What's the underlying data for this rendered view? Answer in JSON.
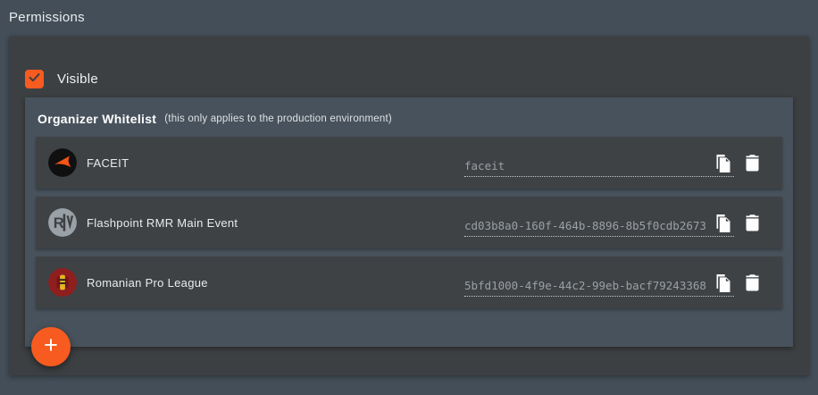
{
  "page": {
    "title": "Permissions"
  },
  "visible_checkbox": {
    "label": "Visible",
    "checked": true
  },
  "whitelist": {
    "title": "Organizer Whitelist",
    "note": "(this only applies to the production environment)",
    "rows": [
      {
        "name": "FACEIT",
        "value": "faceit"
      },
      {
        "name": "Flashpoint RMR Main Event",
        "value": "cd03b8a0-160f-464b-8896-8b5f0cdb2673"
      },
      {
        "name": "Romanian Pro League",
        "value": "5bfd1000-4f9e-44c2-99eb-bacf79243368"
      }
    ],
    "add_button_glyph": "+"
  },
  "icons": {
    "checkmark": "checkmark-icon",
    "copy": "copy-icon",
    "trash": "trash-icon",
    "plus": "plus-icon"
  },
  "colors": {
    "accent_orange": "#f75b1f",
    "page_background": "#434e58",
    "outer_panel": "#3d4043",
    "inner_panel": "#48525c",
    "row_background": "#3f4245",
    "input_text": "#9aa0a4"
  }
}
